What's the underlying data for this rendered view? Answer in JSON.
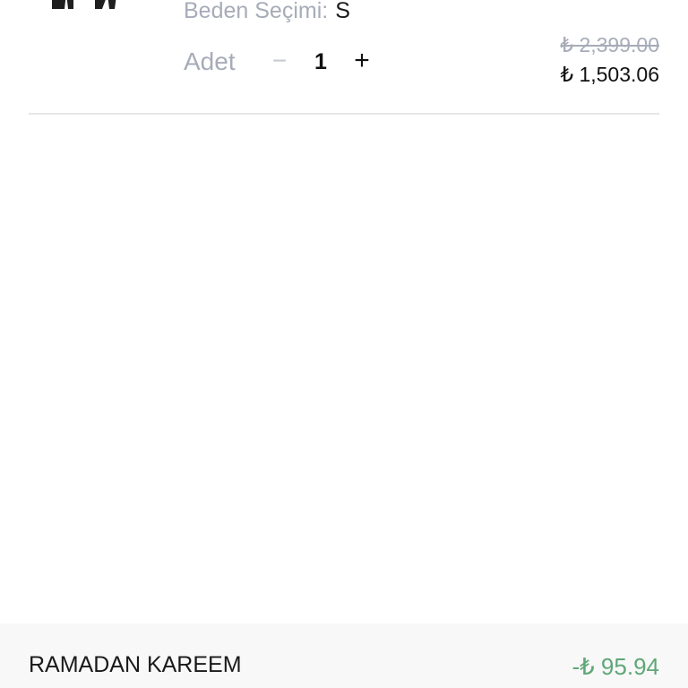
{
  "cart_item": {
    "size_label": "Beden Seçimi:",
    "size_value": "S",
    "quantity_label": "Adet",
    "quantity_minus": "−",
    "quantity_value": "1",
    "quantity_plus": "+",
    "old_price": "₺ 2,399.00",
    "new_price": "₺ 1,503.06"
  },
  "summary": {
    "coupon_name": "RAMADAN KAREEM",
    "discount_amount": "-₺ 95.94"
  },
  "colors": {
    "muted_text": "#a6acb8",
    "primary_text": "#111111",
    "discount_green": "#5fa777",
    "summary_background": "#f8f8f8",
    "divider": "#e6e6e6"
  },
  "icons": {
    "product_image": "product-thumbnail-dark-jacket"
  }
}
